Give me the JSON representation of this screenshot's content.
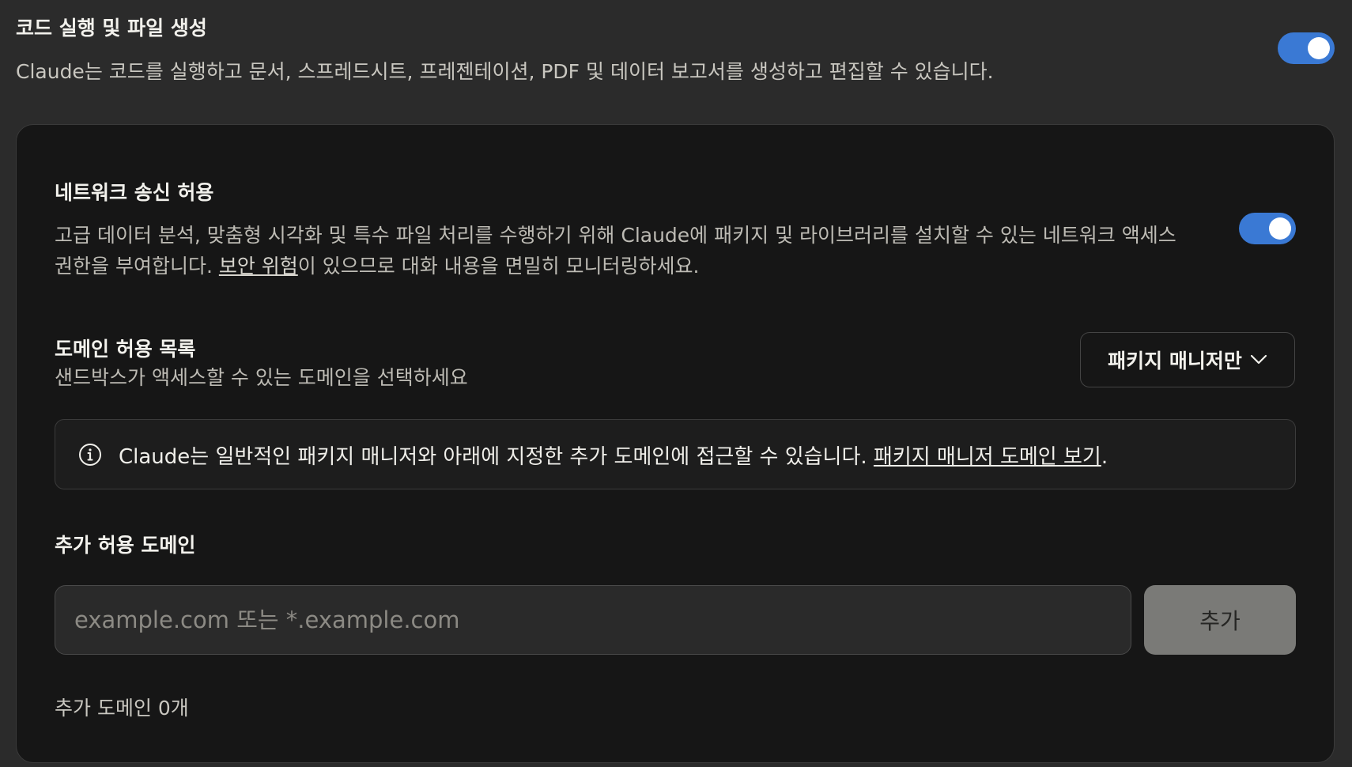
{
  "code_exec": {
    "title": "코드 실행 및 파일 생성",
    "description": "Claude는 코드를 실행하고 문서, 스프레드시트, 프레젠테이션, PDF 및 데이터 보고서를 생성하고 편집할 수 있습니다.",
    "enabled": true
  },
  "network": {
    "title": "네트워크 송신 허용",
    "description_before": "고급 데이터 분석, 맞춤형 시각화 및 특수 파일 처리를 수행하기 위해 Claude에 패키지 및 라이브러리를 설치할 수 있는 네트워크 액세스 권한을 부여합니다. ",
    "security_link": "보안 위험",
    "description_after": "이 있으므로 대화 내용을 면밀히 모니터링하세요.",
    "enabled": true
  },
  "allowlist": {
    "title": "도메인 허용 목록",
    "subtitle": "샌드박스가 액세스할 수 있는 도메인을 선택하세요",
    "selected_option": "패키지 매니저만",
    "info_text": "Claude는 일반적인 패키지 매니저와 아래에 지정한 추가 도메인에 접근할 수 있습니다. ",
    "info_link": "패키지 매니저 도메인 보기",
    "info_period": "."
  },
  "additional": {
    "title": "추가 허용 도메인",
    "input_placeholder": "example.com 또는 *.example.com",
    "input_value": "",
    "add_label": "추가",
    "count_text": "추가 도메인 0개"
  },
  "colors": {
    "toggle_on": "#3a79d4",
    "card_bg": "#161616",
    "page_bg": "#2b2b2b"
  }
}
